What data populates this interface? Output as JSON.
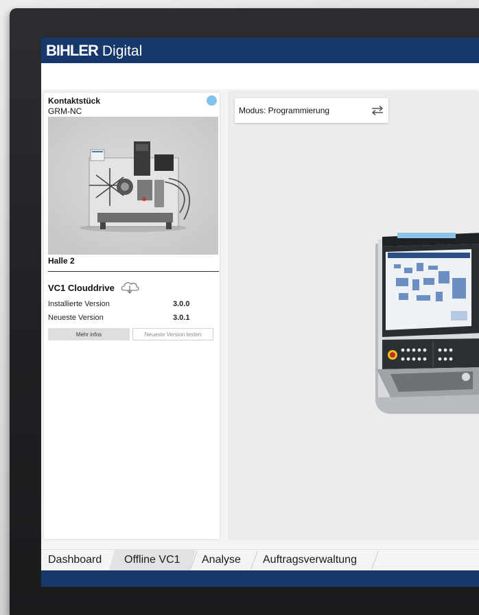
{
  "header": {
    "brand": "BIHLER",
    "product": "Digital"
  },
  "machine_card": {
    "title": "Kontaktstück",
    "model": "GRM-NC",
    "status_color": "#7fc3ea",
    "location": "Halle 2",
    "app": {
      "name": "VC1 Clouddrive",
      "icon": "cloud-download-icon",
      "rows": [
        {
          "label": "Installierte Version",
          "value": "3.0.0"
        },
        {
          "label": "Neueste Version",
          "value": "3.0.1"
        }
      ],
      "buttons": {
        "info": "Mehr infos",
        "test": "Neueste Version testen"
      }
    }
  },
  "main": {
    "mode_label": "Modus: Programmierung",
    "mode_icon": "swap-icon"
  },
  "tabs": [
    {
      "label": "Dashboard",
      "active": false
    },
    {
      "label": "Offline VC1",
      "active": true
    },
    {
      "label": "Analyse",
      "active": false
    },
    {
      "label": "Auftragsverwaltung",
      "active": false
    }
  ],
  "colors": {
    "brand_blue": "#16386a",
    "status_dot": "#7fc3ea",
    "active_tab": "#e2e2e2"
  }
}
